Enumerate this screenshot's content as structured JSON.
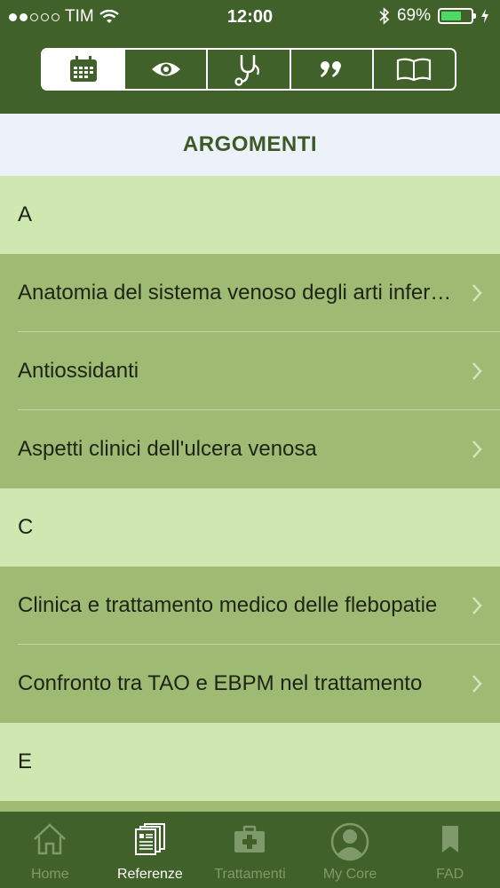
{
  "status": {
    "carrier": "TIM",
    "time": "12:00",
    "battery": "69%",
    "battery_level": 0.69
  },
  "segments": [
    {
      "icon": "calendar-icon",
      "active": true
    },
    {
      "icon": "eye-icon",
      "active": false
    },
    {
      "icon": "stethoscope-icon",
      "active": false
    },
    {
      "icon": "quote-icon",
      "active": false
    },
    {
      "icon": "book-icon",
      "active": false
    }
  ],
  "section": {
    "title": "ARGOMENTI"
  },
  "list": {
    "sections": [
      {
        "letter": "A",
        "items": [
          "Anatomia del sistema venoso degli arti inferiori",
          "Antiossidanti",
          "Aspetti clinici dell'ulcera venosa"
        ]
      },
      {
        "letter": "C",
        "items": [
          "Clinica e trattamento medico delle flebopatie",
          "Confronto tra TAO e EBPM nel trattamento"
        ]
      },
      {
        "letter": "E",
        "items": []
      }
    ]
  },
  "tabbar": {
    "items": [
      {
        "label": "Home",
        "icon": "home-icon",
        "active": false
      },
      {
        "label": "Referenze",
        "icon": "documents-icon",
        "active": true
      },
      {
        "label": "Trattamenti",
        "icon": "medkit-icon",
        "active": false
      },
      {
        "label": "My Core",
        "icon": "user-icon",
        "active": false
      },
      {
        "label": "FAD",
        "icon": "bookmark-icon",
        "active": false
      }
    ]
  },
  "colors": {
    "header": "#40622a",
    "section_bg": "#edf2fa",
    "letter_row": "#cfe8b2",
    "item_row": "#9fbb73",
    "accent_text": "#3b5a26",
    "tab_inactive": "#7f9a6a"
  }
}
